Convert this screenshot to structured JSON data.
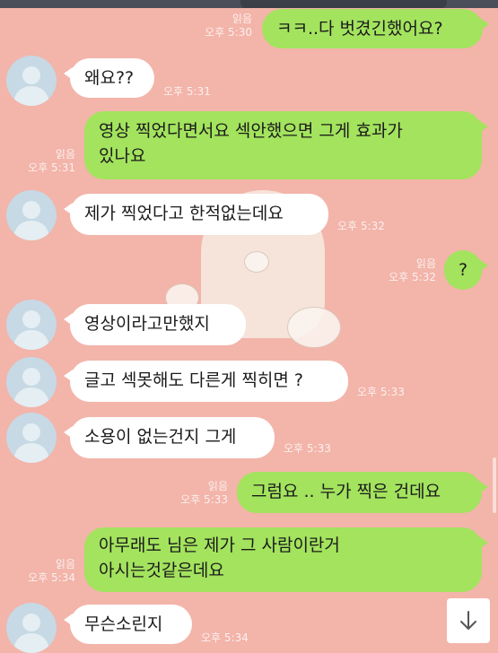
{
  "colors": {
    "background": "#f3b4aa",
    "incoming_bubble": "#ffffff",
    "outgoing_bubble": "#a3e35e",
    "meta_text": "#fbf0ee"
  },
  "messages": [
    {
      "direction": "out",
      "lines": [
        "ㅋㅋ..다 벗겼긴했어요?"
      ],
      "read": "읽음",
      "time": "오후 5:30"
    },
    {
      "direction": "in",
      "lines": [
        "왜요??"
      ],
      "time": "오후 5:31"
    },
    {
      "direction": "out",
      "lines": [
        "영상 찍었다면서요 섹안했으면 그게 효과가",
        "있나요"
      ],
      "read": "읽음",
      "time": "오후 5:31"
    },
    {
      "direction": "in",
      "lines": [
        "제가 찍었다고 한적없는데요"
      ],
      "time": "오후 5:32"
    },
    {
      "direction": "out",
      "lines": [
        "?"
      ],
      "read": "읽음",
      "time": "오후 5:32"
    },
    {
      "direction": "in",
      "lines": [
        "영상이라고만했지"
      ],
      "time": ""
    },
    {
      "direction": "in",
      "lines": [
        "글고 섹못해도 다른게 찍히면 ?"
      ],
      "time": "오후 5:33"
    },
    {
      "direction": "in",
      "lines": [
        "소용이 없는건지 그게"
      ],
      "time": "오후 5:33"
    },
    {
      "direction": "out",
      "lines": [
        "그럼요 .. 누가 찍은 건데요"
      ],
      "read": "읽음",
      "time": "오후 5:33"
    },
    {
      "direction": "out",
      "lines": [
        "아무래도 님은 제가 그 사람이란거",
        "아시는것같은데요"
      ],
      "read": "읽음",
      "time": "오후 5:34"
    },
    {
      "direction": "in",
      "lines": [
        "무슨소린지"
      ],
      "time": "오후 5:34"
    }
  ],
  "icons": {
    "avatar": "default-profile-icon",
    "scroll_down": "arrow-down-icon"
  }
}
